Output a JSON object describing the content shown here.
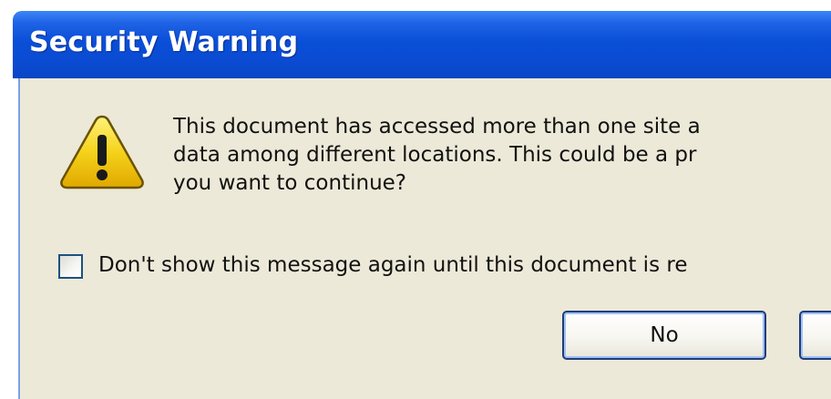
{
  "dialog": {
    "title": "Security Warning",
    "message_lines": [
      "This document has accessed more than one site a",
      "data among different locations. This could be a pr",
      "you want to continue?"
    ],
    "checkbox": {
      "label": "Don't show this message again until this document is re",
      "checked": false
    },
    "buttons": {
      "no_label": "No",
      "yes_label": ""
    },
    "icon": "warning-icon"
  },
  "colors": {
    "titlebar": "#0a4fd8",
    "client_background": "#ece9d8",
    "warning_yellow": "#f5d21a"
  }
}
